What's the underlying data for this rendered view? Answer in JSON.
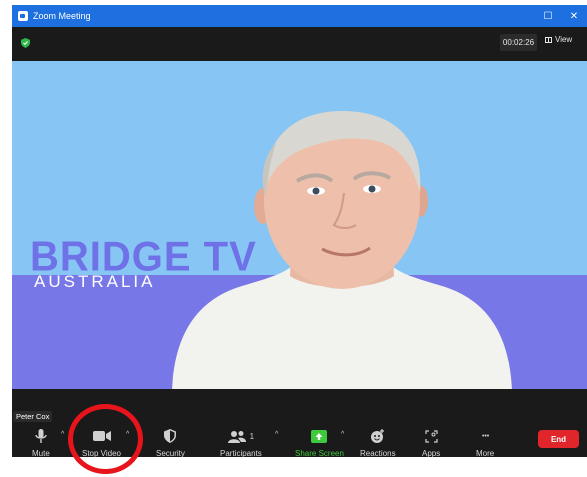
{
  "window": {
    "title": "Zoom Meeting"
  },
  "window_controls": {
    "maximize": "☐",
    "close": "✕"
  },
  "topbar": {
    "timer": "00:02:26",
    "view_label": "View"
  },
  "background": {
    "brand_main": "BRIDGE TV",
    "brand_sub": "AUSTRALIA"
  },
  "participant": {
    "name": "Peter Cox"
  },
  "toolbar": {
    "mute": "Mute",
    "stop_video": "Stop Video",
    "security": "Security",
    "participants": "Participants",
    "participants_count": "1",
    "share_screen": "Share Screen",
    "reactions": "Reactions",
    "apps": "Apps",
    "more": "More",
    "more_glyph": "• • •",
    "end": "End",
    "caret": "^"
  },
  "colors": {
    "titlebar": "#1e6fe0",
    "share_green": "#3fc93f",
    "end_red": "#e0262b",
    "highlight_circle": "#e8141b"
  },
  "icons": [
    "zoom-app-icon",
    "shield-icon",
    "grid-view-icon",
    "microphone-icon",
    "camera-icon",
    "security-shield-icon",
    "participants-icon",
    "share-screen-icon",
    "reactions-icon",
    "apps-icon",
    "more-dots-icon"
  ]
}
